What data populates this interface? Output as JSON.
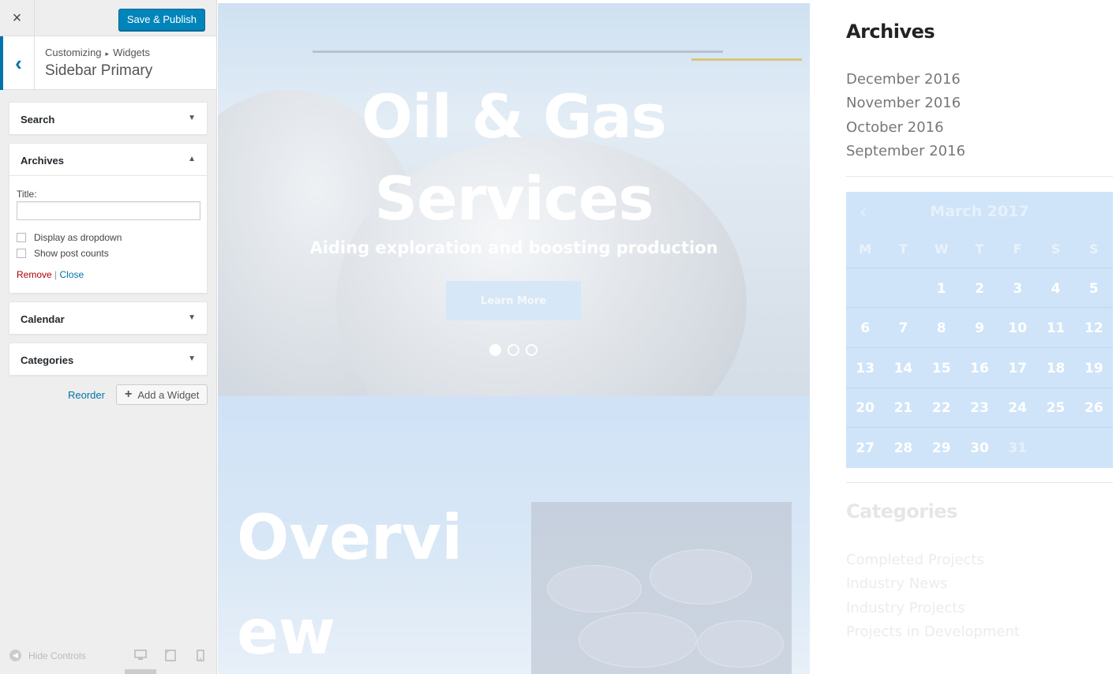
{
  "customizer": {
    "close_icon": "×",
    "save_label": "Save & Publish",
    "back_icon": "‹",
    "breadcrumb_root": "Customizing",
    "breadcrumb_sep": "▸",
    "breadcrumb_child": "Widgets",
    "section_title": "Sidebar Primary",
    "widgets": [
      {
        "title": "Search",
        "arrow": "▼"
      },
      {
        "title": "Archives",
        "arrow": "▲"
      },
      {
        "title": "Calendar",
        "arrow": "▼"
      },
      {
        "title": "Categories",
        "arrow": "▼"
      }
    ],
    "archives_form": {
      "title_label": "Title:",
      "title_value": "",
      "dropdown_label": "Display as dropdown",
      "dropdown_checked": false,
      "counts_label": "Show post counts",
      "counts_checked": false,
      "remove_label": "Remove",
      "separator": "|",
      "close_label": "Close"
    },
    "reorder_label": "Reorder",
    "add_widget_icon": "+",
    "add_widget_label": "Add a Widget",
    "hide_controls_icon": "◀",
    "hide_controls_label": "Hide Controls",
    "device_icons": [
      "desktop-icon",
      "tablet-icon",
      "mobile-icon"
    ]
  },
  "preview": {
    "hero_title": "Oil & Gas Services",
    "hero_subtitle": "Aiding exploration and boosting production",
    "hero_button": "Learn More",
    "slides": 3,
    "active_slide": 1,
    "overview_title": "Overview"
  },
  "site_sidebar": {
    "archives_title": "Archives",
    "archives": [
      "December 2016",
      "November 2016",
      "October 2016",
      "September 2016"
    ],
    "calendar": {
      "prev_icon": "‹",
      "month": "March 2017",
      "weekdays": [
        "M",
        "T",
        "W",
        "T",
        "F",
        "S",
        "S"
      ],
      "weeks": [
        [
          "",
          "",
          "1",
          "2",
          "3",
          "4",
          "5"
        ],
        [
          "6",
          "7",
          "8",
          "9",
          "10",
          "11",
          "12"
        ],
        [
          "13",
          "14",
          "15",
          "16",
          "17",
          "18",
          "19"
        ],
        [
          "20",
          "21",
          "22",
          "23",
          "24",
          "25",
          "26"
        ],
        [
          "27",
          "28",
          "29",
          "30",
          "31",
          "",
          ""
        ]
      ]
    },
    "categories_title": "Categories",
    "categories": [
      "Completed Projects",
      "Industry News",
      "Industry Projects",
      "Projects in Development"
    ]
  },
  "colors": {
    "accent": "#0085ba",
    "link": "#0073aa",
    "remove": "#aa0000",
    "calendar_bg": "#cfe4f9"
  }
}
